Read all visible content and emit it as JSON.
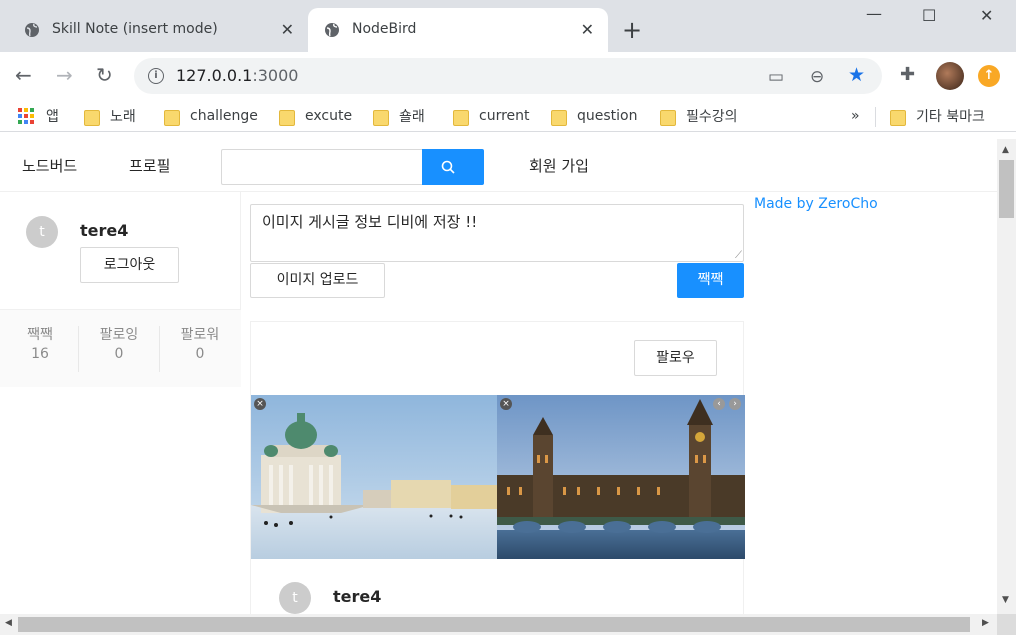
{
  "tabs": [
    {
      "title": "Skill Note (insert mode)",
      "active": false
    },
    {
      "title": "NodeBird",
      "active": true
    }
  ],
  "window_controls": {
    "minimize": "—",
    "maximize": "☐",
    "close": "✕"
  },
  "address": {
    "host": "127.0.0.1",
    "port": ":3000"
  },
  "bookmarks": {
    "apps": "앱",
    "items": [
      "노래",
      "challenge",
      "excute",
      "숄래",
      "current",
      "question",
      "필수강의"
    ],
    "overflow": "»",
    "other": "기타 북마크"
  },
  "app": {
    "menu": {
      "home": "노드버드",
      "profile": "프로필",
      "signup": "회원 가입"
    },
    "search": {
      "placeholder": ""
    },
    "profile": {
      "avatar_letter": "t",
      "nickname": "tere4",
      "logout": "로그아웃",
      "stats": [
        {
          "label": "짹짹",
          "value": "16"
        },
        {
          "label": "팔로잉",
          "value": "0"
        },
        {
          "label": "팔로워",
          "value": "0"
        }
      ]
    },
    "composer": {
      "text": "이미지 게시글 정보 디비에 저장 !!",
      "upload": "이미지 업로드",
      "submit": "짹짹"
    },
    "post": {
      "follow": "팔로우",
      "avatar_letter": "t",
      "nickname": "tere4"
    },
    "footer_link": "Made by ZeroCho"
  }
}
